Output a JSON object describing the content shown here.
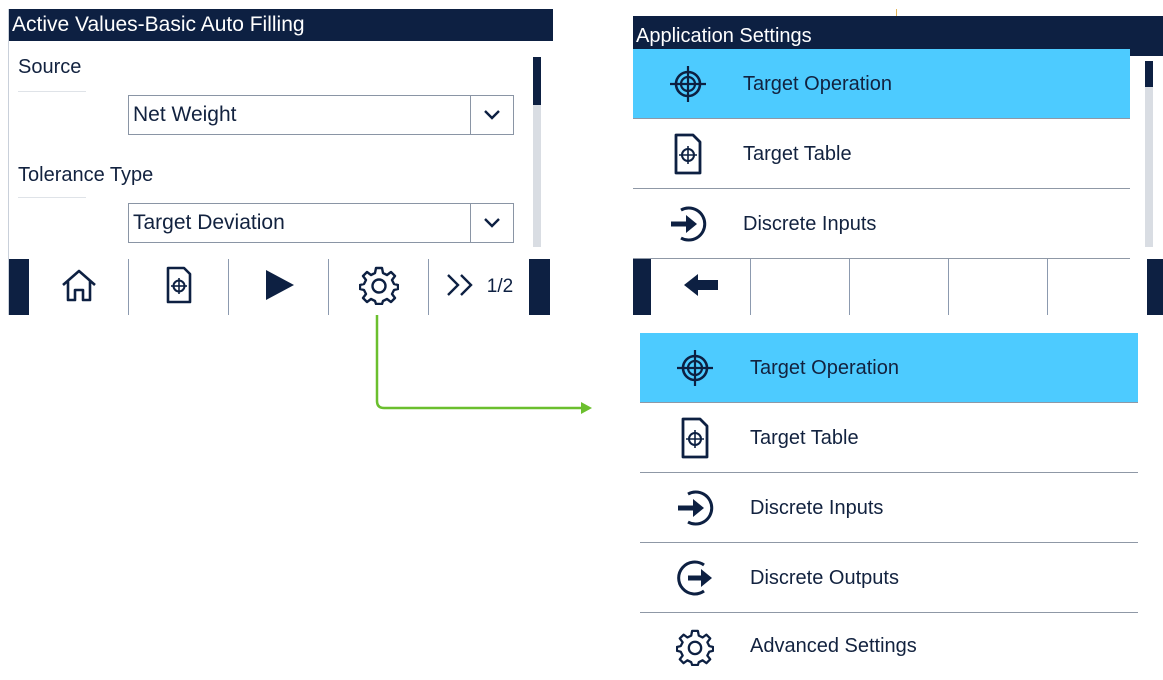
{
  "left_screen": {
    "title": "Active Values-Basic Auto Filling",
    "source": {
      "label": "Source",
      "value": "Net Weight"
    },
    "tolerance": {
      "label": "Tolerance Type",
      "value": "Target Deviation"
    },
    "softkeys": [
      {
        "icon": "home-icon"
      },
      {
        "icon": "target-table-icon"
      },
      {
        "icon": "play-icon"
      },
      {
        "icon": "gear-icon"
      },
      {
        "icon": "next-page-icon",
        "label": "1/2"
      }
    ]
  },
  "right_screen": {
    "title": "Application Settings",
    "items": [
      {
        "label": "Target Operation",
        "icon": "crosshair-icon",
        "selected": true
      },
      {
        "label": "Target Table",
        "icon": "target-table-icon"
      },
      {
        "label": "Discrete Inputs",
        "icon": "discrete-input-icon"
      }
    ],
    "softkeys": [
      {
        "icon": "back-arrow-icon"
      },
      {},
      {},
      {},
      {}
    ]
  },
  "expanded_menu": {
    "items": [
      {
        "label": "Target Operation",
        "icon": "crosshair-icon",
        "selected": true
      },
      {
        "label": "Target Table",
        "icon": "target-table-icon"
      },
      {
        "label": "Discrete Inputs",
        "icon": "discrete-input-icon"
      },
      {
        "label": "Discrete Outputs",
        "icon": "discrete-output-icon"
      },
      {
        "label": "Advanced Settings",
        "icon": "gear-icon"
      }
    ]
  },
  "colors": {
    "navy": "#0d2042",
    "highlight": "#4dcbff",
    "arrow": "#6bbf2e"
  }
}
